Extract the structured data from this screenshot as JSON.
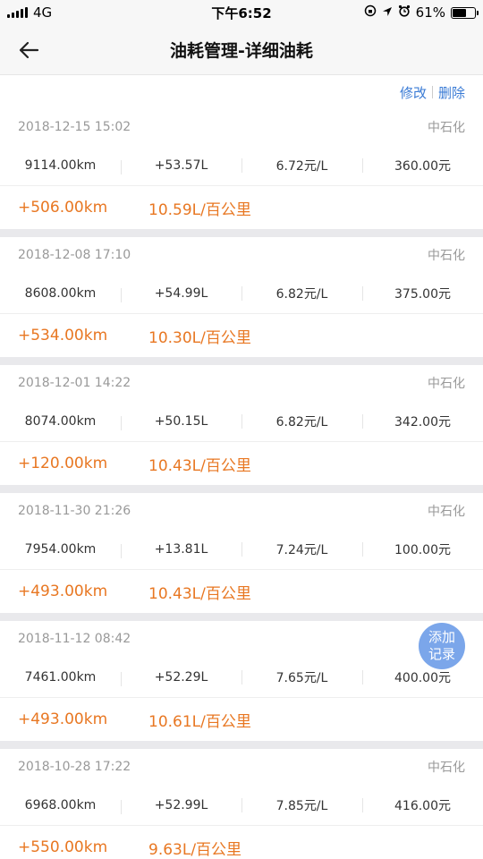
{
  "status_bar": {
    "carrier": "4G",
    "time": "下午6:52",
    "battery": "61%",
    "battery_level": 0.61
  },
  "header": {
    "title": "油耗管理-详细油耗",
    "back_icon": "back-arrow-icon"
  },
  "actions": {
    "edit_label": "修改",
    "delete_label": "删除"
  },
  "records": [
    {
      "datetime": "2018-12-15 15:02",
      "station": "中石化",
      "odometer": "9114.00km",
      "fuel": "+53.57L",
      "price": "6.72元/L",
      "amount": "360.00元",
      "distance": "+506.00km",
      "consumption": "10.59L/百公里"
    },
    {
      "datetime": "2018-12-08 17:10",
      "station": "中石化",
      "odometer": "8608.00km",
      "fuel": "+54.99L",
      "price": "6.82元/L",
      "amount": "375.00元",
      "distance": "+534.00km",
      "consumption": "10.30L/百公里"
    },
    {
      "datetime": "2018-12-01 14:22",
      "station": "中石化",
      "odometer": "8074.00km",
      "fuel": "+50.15L",
      "price": "6.82元/L",
      "amount": "342.00元",
      "distance": "+120.00km",
      "consumption": "10.43L/百公里"
    },
    {
      "datetime": "2018-11-30 21:26",
      "station": "中石化",
      "odometer": "7954.00km",
      "fuel": "+13.81L",
      "price": "7.24元/L",
      "amount": "100.00元",
      "distance": "+493.00km",
      "consumption": "10.43L/百公里"
    },
    {
      "datetime": "2018-11-12 08:42",
      "station": "",
      "odometer": "7461.00km",
      "fuel": "+52.29L",
      "price": "7.65元/L",
      "amount": "400.00元",
      "distance": "+493.00km",
      "consumption": "10.61L/百公里"
    },
    {
      "datetime": "2018-10-28 17:22",
      "station": "中石化",
      "odometer": "6968.00km",
      "fuel": "+52.99L",
      "price": "7.85元/L",
      "amount": "416.00元",
      "distance": "+550.00km",
      "consumption": "9.63L/百公里"
    }
  ],
  "fab": {
    "line1": "添加",
    "line2": "记录"
  },
  "colors": {
    "accent_blue": "#3a7bd5",
    "distance_orange": "#e87722",
    "fab_blue": "#6496e6"
  }
}
